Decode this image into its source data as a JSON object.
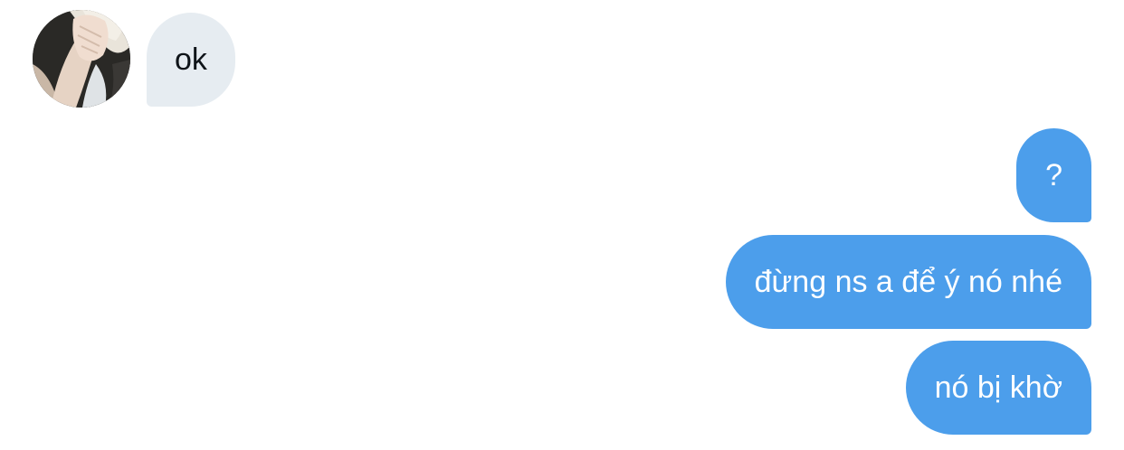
{
  "conversation": {
    "incoming": [
      {
        "text": "ok"
      }
    ],
    "outgoing": [
      {
        "text": "?"
      },
      {
        "text": "đừng ns a để ý nó nhé"
      },
      {
        "text": "nó bị khờ"
      }
    ]
  },
  "colors": {
    "incoming_bubble": "#e6ecf1",
    "outgoing_bubble": "#4c9eeb",
    "incoming_text": "#0f1419",
    "outgoing_text": "#ffffff"
  }
}
